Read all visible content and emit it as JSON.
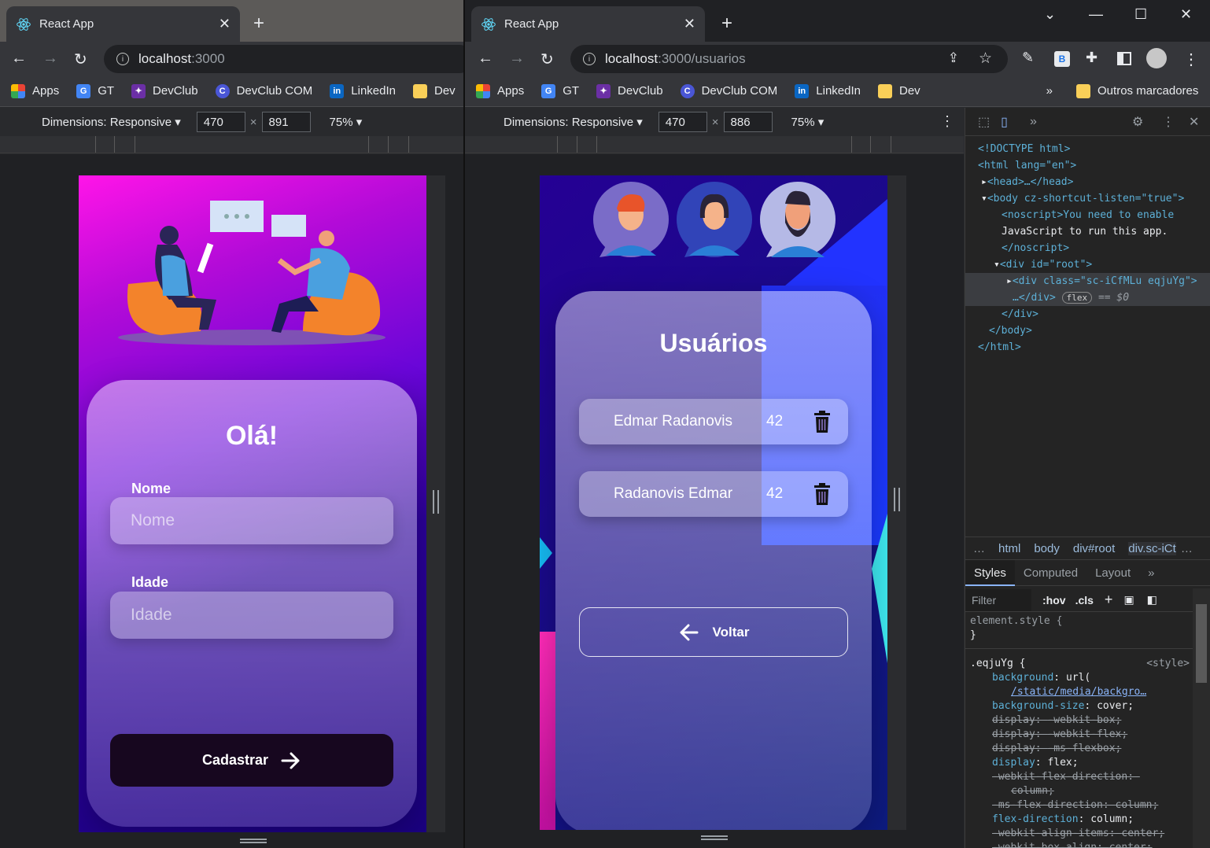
{
  "left": {
    "tab_title": "React App",
    "url_host": "localhost",
    "url_rest": ":3000",
    "bookmarks": [
      "Apps",
      "GT",
      "DevClub",
      "DevClub COM",
      "LinkedIn",
      "Dev"
    ],
    "dimensions_label": "Dimensions: Responsive",
    "width": "470",
    "height": "891",
    "zoom": "75%",
    "form": {
      "title": "Olá!",
      "name_label": "Nome",
      "name_placeholder": "Nome",
      "age_label": "Idade",
      "age_placeholder": "Idade",
      "submit_label": "Cadastrar"
    }
  },
  "right": {
    "tab_title": "React App",
    "url_host": "localhost",
    "url_rest": ":3000/usuarios",
    "bookmarks": [
      "Apps",
      "GT",
      "DevClub",
      "DevClub COM",
      "LinkedIn",
      "Dev"
    ],
    "other_bookmarks": "Outros marcadores",
    "dimensions_label": "Dimensions: Responsive",
    "width": "470",
    "height": "886",
    "zoom": "75%",
    "page": {
      "title": "Usuários",
      "users": [
        {
          "name": "Edmar Radanovis",
          "age": "42"
        },
        {
          "name": "Radanovis Edmar",
          "age": "42"
        }
      ],
      "back_label": "Voltar"
    }
  },
  "devtools": {
    "dom": [
      "<!DOCTYPE html>",
      "<html lang=\"en\">",
      "<head>…</head>",
      "<body cz-shortcut-listen=\"true\">",
      "<noscript>You need to enable",
      "JavaScript to run this app.",
      "</noscript>",
      "<div id=\"root\">",
      "<div class=\"sc-iCfMLu eqjuYg\">",
      "…</div>",
      "flex",
      "== $0",
      "</div>",
      "</body>",
      "</html>"
    ],
    "breadcrumbs": [
      "html",
      "body",
      "div#root",
      "div.sc-iCt"
    ],
    "style_tabs": [
      "Styles",
      "Computed",
      "Layout"
    ],
    "filter_placeholder": "Filter",
    "filter_hov": ":hov",
    "filter_cls": ".cls",
    "element_style": "element.style {",
    "rule_selector": ".eqjuYg {",
    "rule_source": "<style>",
    "rules": [
      {
        "prop": "background",
        "value": "url(",
        "strike": false
      },
      {
        "prop": "",
        "value": "/static/media/backgro…",
        "strike": false,
        "link": true
      },
      {
        "prop": "background-size",
        "value": "cover;",
        "strike": false
      },
      {
        "prop": "display",
        "value": "-webkit-box;",
        "strike": true
      },
      {
        "prop": "display",
        "value": "-webkit-flex;",
        "strike": true
      },
      {
        "prop": "display",
        "value": "-ms-flexbox;",
        "strike": true
      },
      {
        "prop": "display",
        "value": "flex;",
        "strike": false
      },
      {
        "prop": "-webkit-flex-direction",
        "value": "",
        "strike": true
      },
      {
        "prop": "",
        "value": "column;",
        "strike": true
      },
      {
        "prop": "-ms-flex-direction",
        "value": "column;",
        "strike": true
      },
      {
        "prop": "flex-direction",
        "value": "column;",
        "strike": false
      },
      {
        "prop": "-webkit-align-items",
        "value": "center;",
        "strike": true
      },
      {
        "prop": "-webkit-box-align",
        "value": "center;",
        "strike": true
      }
    ]
  }
}
